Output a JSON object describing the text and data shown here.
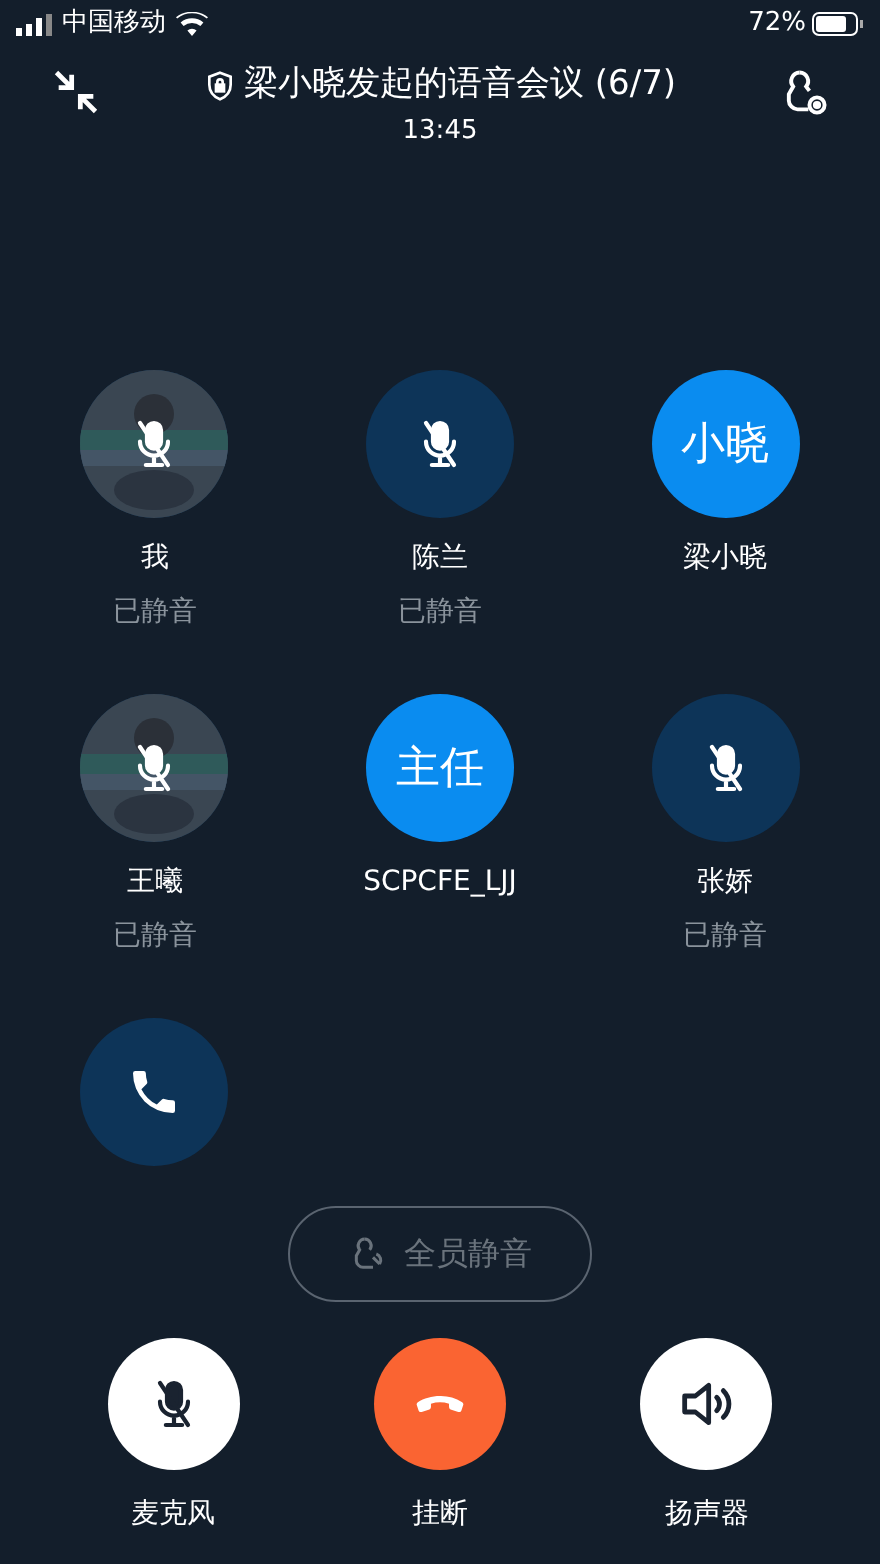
{
  "status_bar": {
    "carrier": "中国移动",
    "battery": "72%"
  },
  "header": {
    "title": "梁小晓发起的语音会议 (6/7)",
    "time": "13:45"
  },
  "participants": [
    {
      "name": "我",
      "status": "已静音",
      "muted": true
    },
    {
      "name": "陈兰",
      "status": "已静音",
      "muted": true,
      "avatar": {
        "kind": "blank"
      }
    },
    {
      "name": "梁小晓",
      "muted": false,
      "avatar": {
        "kind": "initials",
        "text": "小晓",
        "active": true
      }
    },
    {
      "name": "王曦",
      "status": "已静音",
      "muted": true
    },
    {
      "name": "SCPCFE_LJJ",
      "muted": false,
      "avatar": {
        "kind": "initials",
        "text": "主任",
        "active": true
      }
    },
    {
      "name": "张娇",
      "status": "已静音",
      "muted": true,
      "avatar": {
        "kind": "blank"
      }
    },
    {
      "calling": true,
      "muted": false,
      "avatar": {
        "kind": "blank"
      }
    }
  ],
  "mute_all": {
    "label": "全员静音",
    "disabled": true
  },
  "controls": [
    {
      "kind": "mic",
      "label": "麦克风",
      "on": false
    },
    {
      "kind": "hangup",
      "label": "挂断"
    },
    {
      "kind": "speaker",
      "label": "扬声器",
      "on": false
    }
  ]
}
